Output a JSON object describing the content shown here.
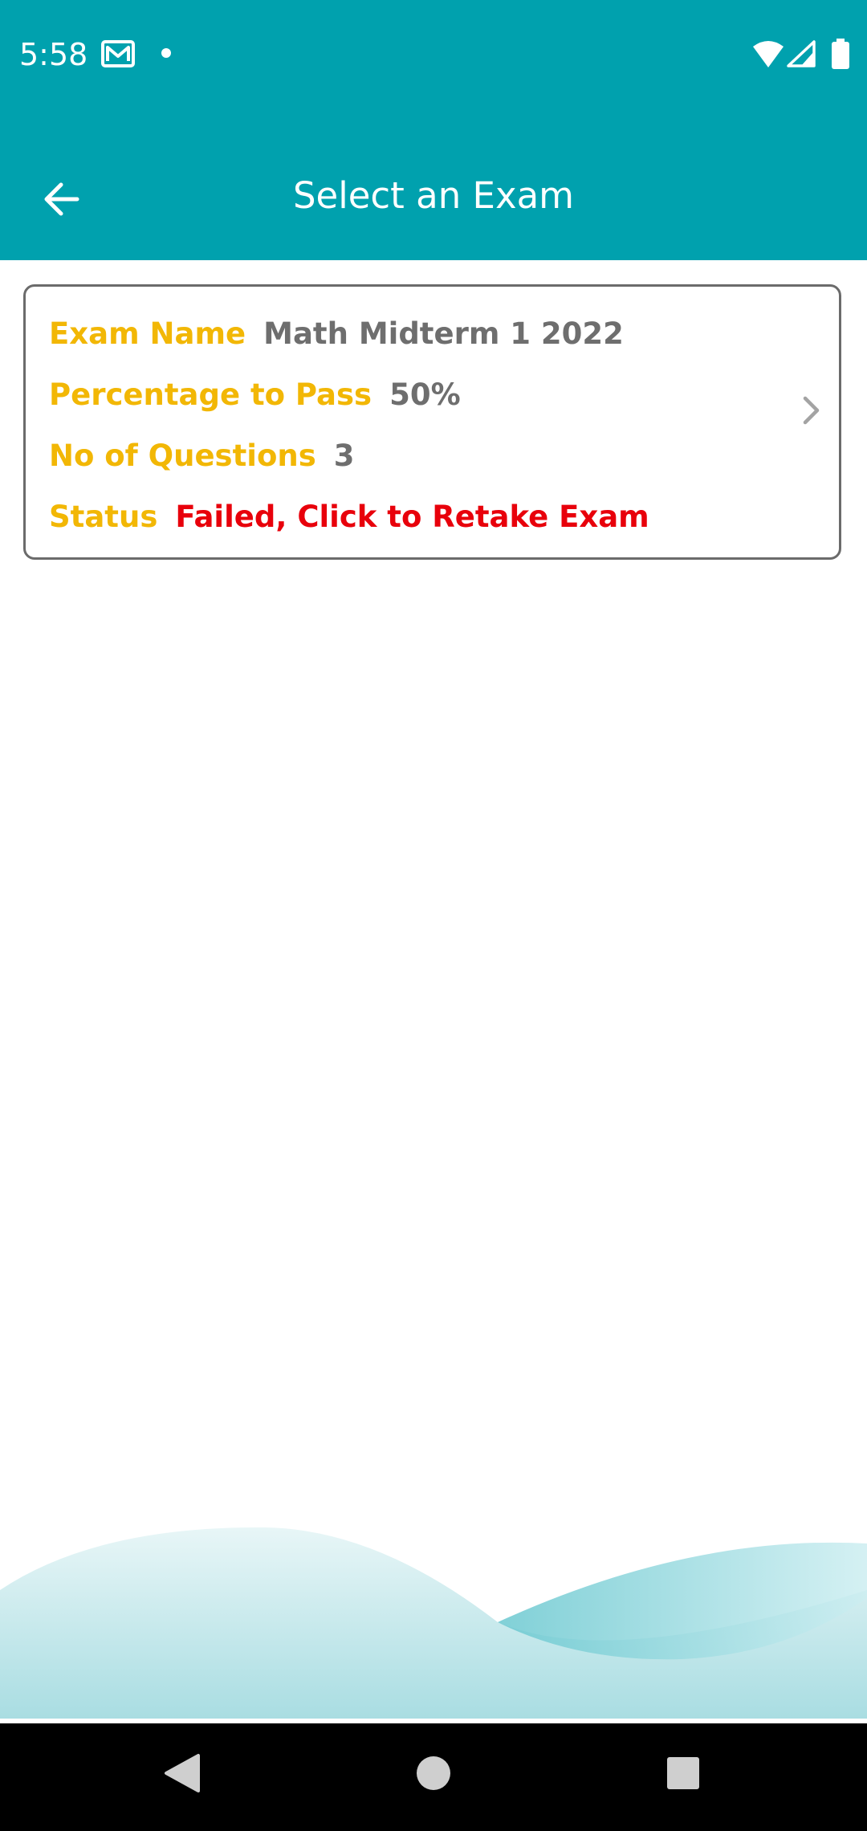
{
  "status_bar": {
    "time": "5:58",
    "icons": [
      "gmail-icon",
      "notification-dot-icon",
      "wifi-icon",
      "signal-icon",
      "battery-icon"
    ]
  },
  "app_bar": {
    "title": "Select an Exam",
    "back_icon": "arrow-back-icon"
  },
  "exams": [
    {
      "name_label": "Exam Name",
      "name_value": "Math Midterm 1 2022",
      "pass_label": "Percentage to Pass",
      "pass_value": "50%",
      "questions_label": "No of Questions",
      "questions_value": "3",
      "status_label": "Status",
      "status_value": "Failed, Click to Retake Exam"
    }
  ],
  "nav_bar": {
    "icons": [
      "back-triangle-icon",
      "home-circle-icon",
      "recents-square-icon"
    ]
  },
  "colors": {
    "primary": "#00a1ae",
    "label": "#f2b705",
    "value": "#6e6e6e",
    "failed": "#e8000b"
  }
}
